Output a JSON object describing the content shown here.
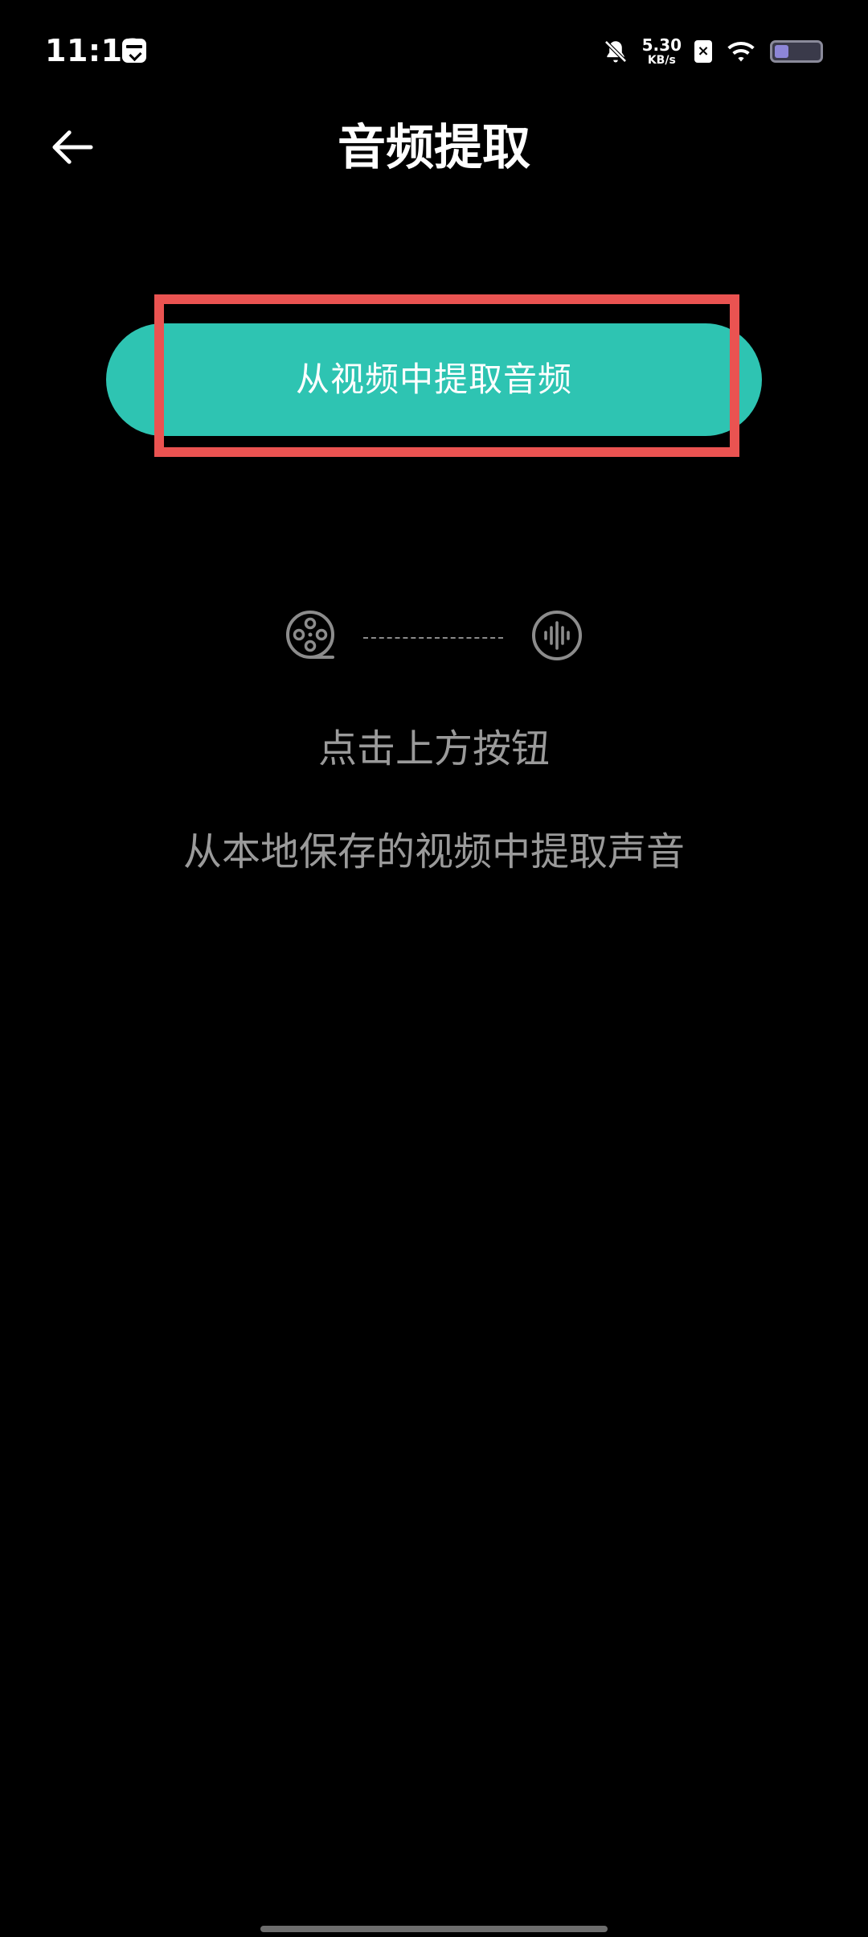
{
  "status_bar": {
    "time": "11:12",
    "net_speed_value": "5.30",
    "net_speed_unit": "KB/s",
    "sim_label": "×",
    "battery_level": 0.32,
    "icons": [
      "mail-app-icon",
      "bell-off-icon",
      "sim-x-icon",
      "wifi-icon",
      "battery-icon"
    ]
  },
  "header": {
    "title": "音频提取",
    "back_icon": "arrow-left-icon"
  },
  "main": {
    "extract_button_label": "从视频中提取音频",
    "illustration": {
      "source_icon": "film-reel-icon",
      "target_icon": "audio-wave-icon"
    },
    "hint_primary": "点击上方按钮",
    "hint_secondary": "从本地保存的视频中提取声音"
  },
  "colors": {
    "background": "#000000",
    "accent": "#2ec4b2",
    "highlight": "#ea5351",
    "hint_text": "#9a9a9a"
  }
}
